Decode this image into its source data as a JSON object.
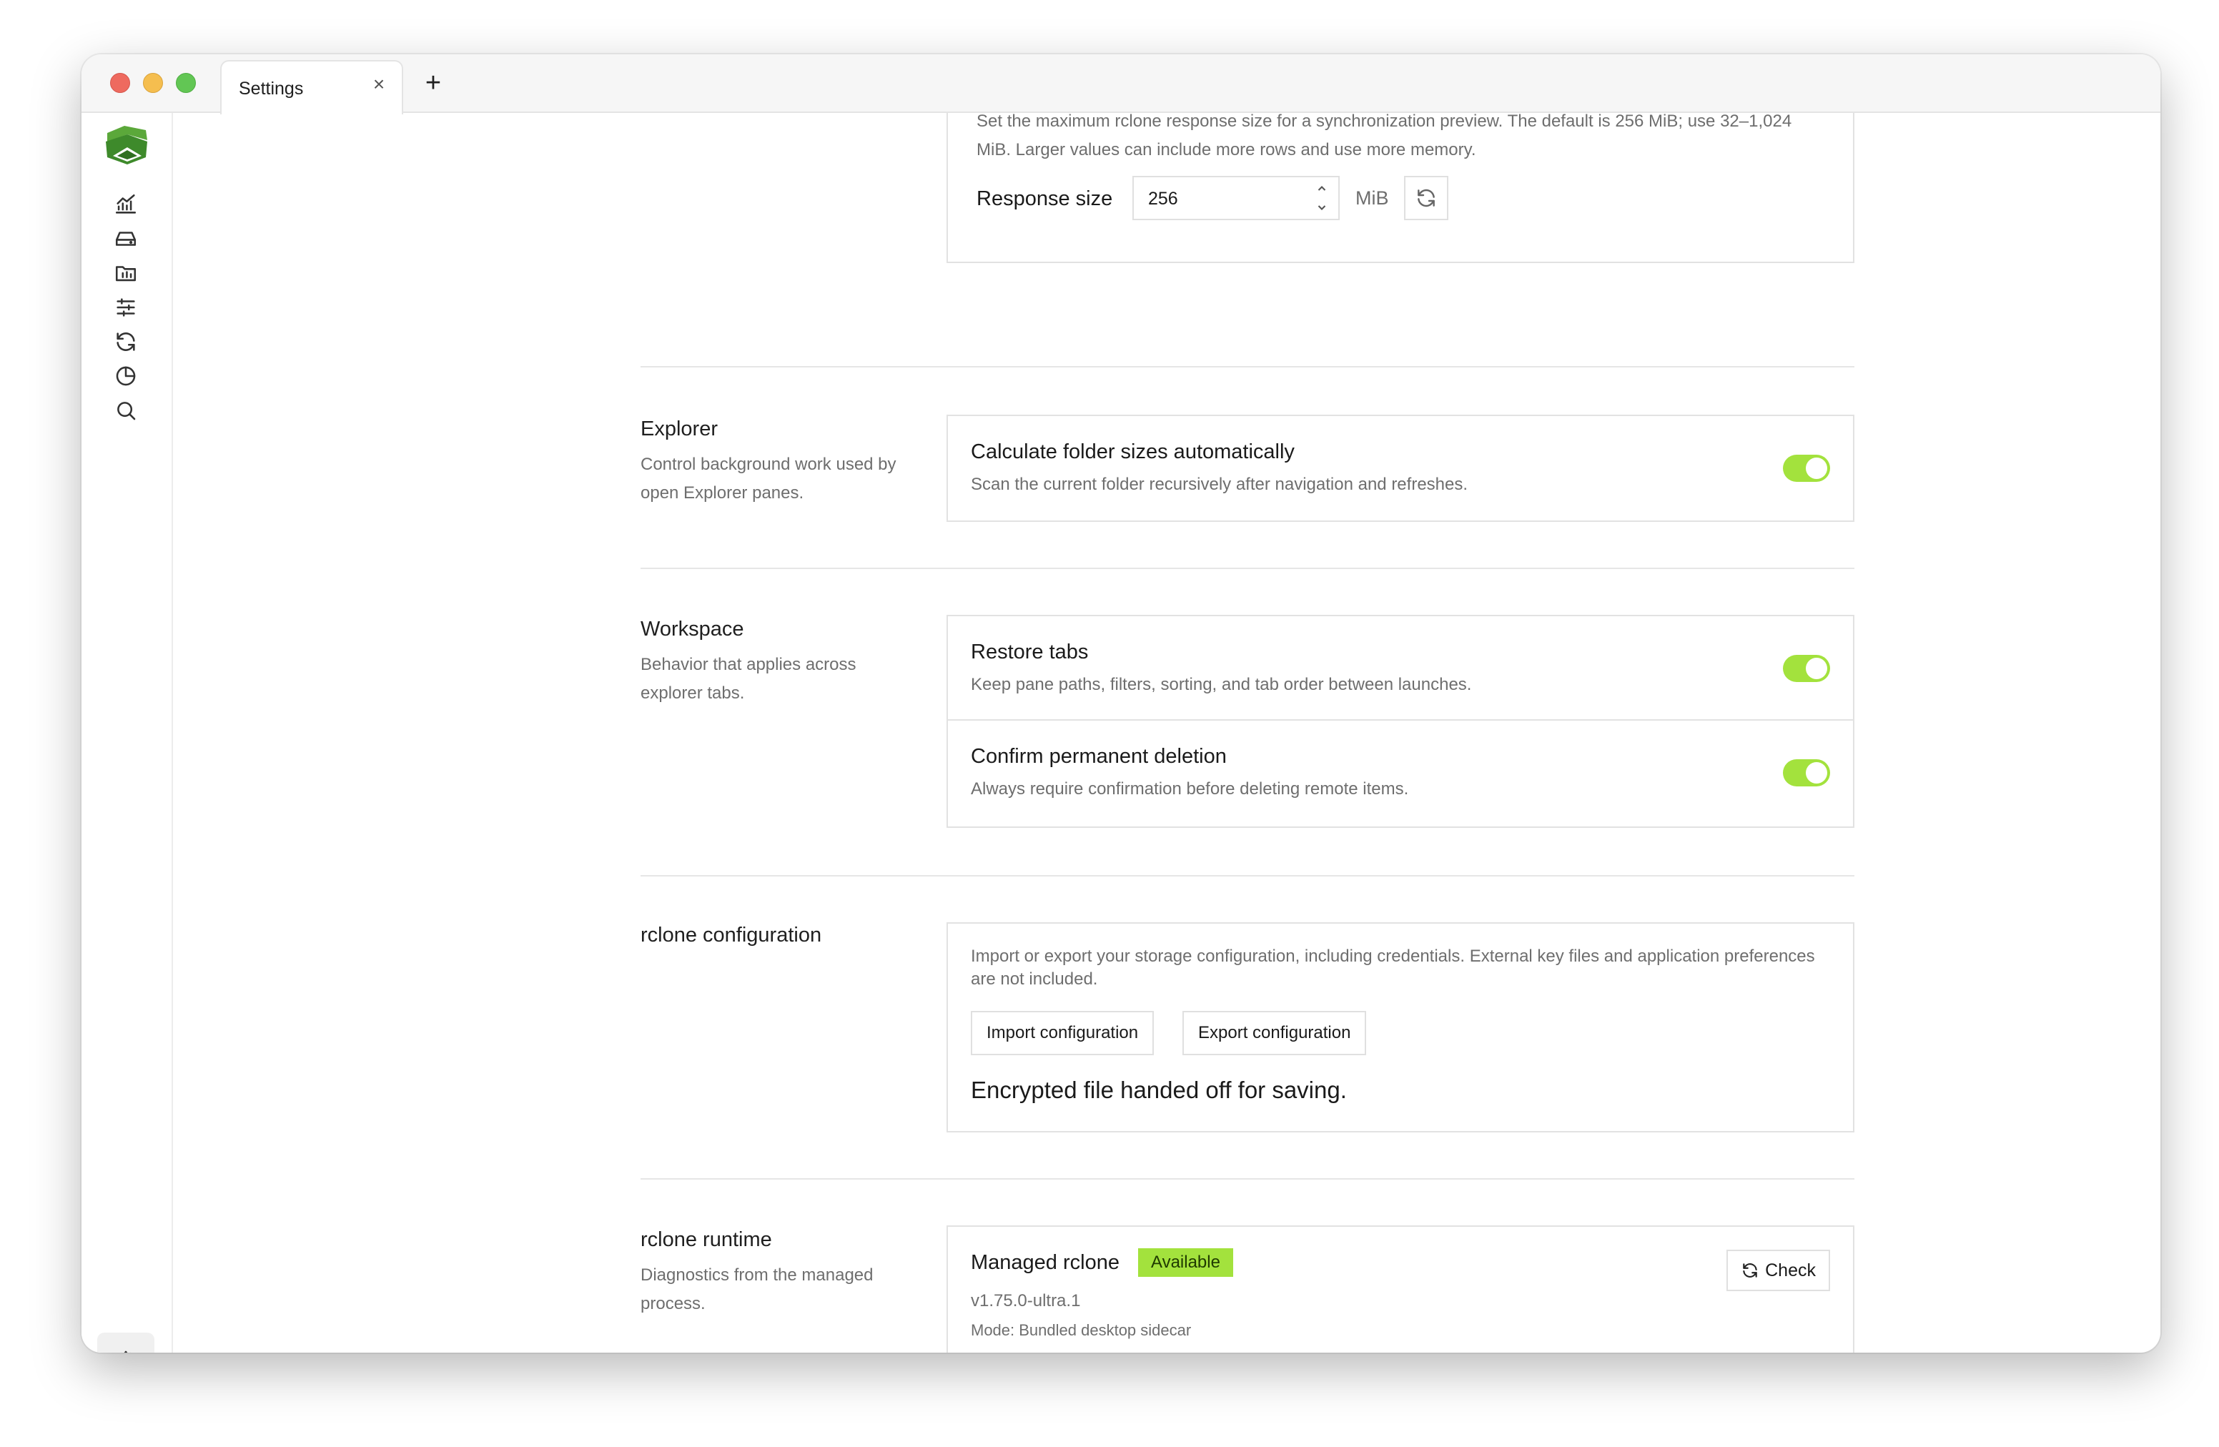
{
  "window": {
    "tab_title": "Settings",
    "tab_close_glyph": "×",
    "new_tab_glyph": "+"
  },
  "sidebar": {
    "items": [
      {
        "name": "chart-icon"
      },
      {
        "name": "drive-icon"
      },
      {
        "name": "folder-icon"
      },
      {
        "name": "sliders-icon"
      },
      {
        "name": "sync-icon"
      },
      {
        "name": "pie-chart-icon"
      },
      {
        "name": "search-icon"
      }
    ],
    "settings_icon": "gear-icon"
  },
  "response": {
    "description": "Set the maximum rclone response size for a synchronization preview. The default is 256 MiB; use 32–1,024 MiB. Larger values can include more rows and use more memory.",
    "label": "Response size",
    "value": "256",
    "unit": "MiB"
  },
  "explorer": {
    "title": "Explorer",
    "description": "Control background work used by open Explorer panes.",
    "rows": [
      {
        "title": "Calculate folder sizes automatically",
        "subtitle": "Scan the current folder recursively after navigation and refreshes.",
        "enabled": true
      }
    ]
  },
  "workspace": {
    "title": "Workspace",
    "description": "Behavior that applies across explorer tabs.",
    "rows": [
      {
        "title": "Restore tabs",
        "subtitle": "Keep pane paths, filters, sorting, and tab order between launches.",
        "enabled": true
      },
      {
        "title": "Confirm permanent deletion",
        "subtitle": "Always require confirmation before deleting remote items.",
        "enabled": true
      }
    ]
  },
  "config": {
    "title": "rclone configuration",
    "description": "Import or export your storage configuration, including credentials. External key files and application preferences are not included.",
    "import_label": "Import configuration",
    "export_label": "Export configuration",
    "status": "Encrypted file handed off for saving."
  },
  "runtime": {
    "title": "rclone runtime",
    "description": "Diagnostics from the managed process.",
    "name": "Managed rclone",
    "badge": "Available",
    "version": "v1.75.0-ultra.1",
    "mode": "Mode: Bundled desktop sidecar",
    "check_label": "Check"
  },
  "colors": {
    "accent": "#a3e23d",
    "border": "#e2e2e2",
    "muted_text": "#6e6e6e"
  }
}
